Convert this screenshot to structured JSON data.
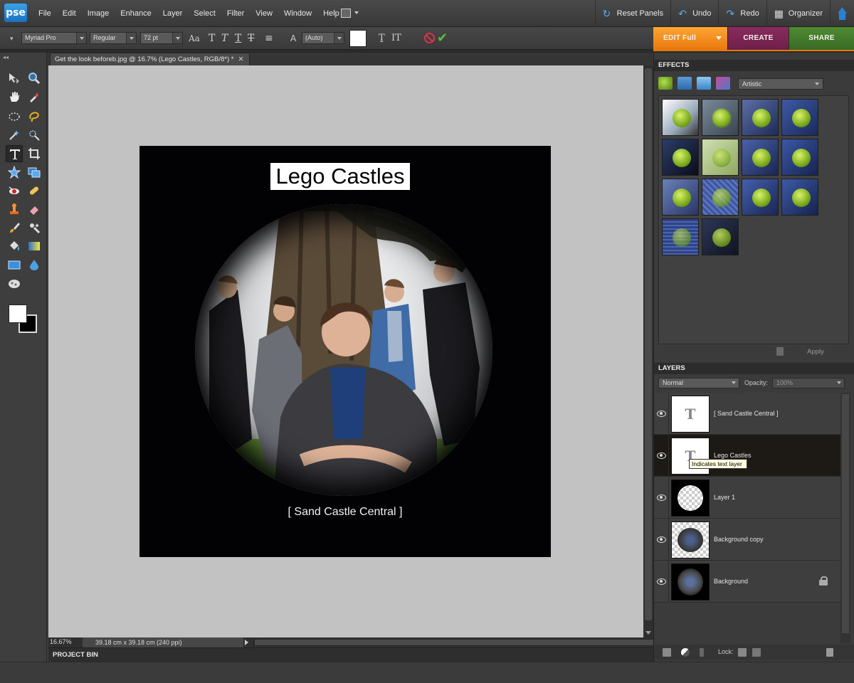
{
  "app": {
    "logo": "pse"
  },
  "menu": [
    "File",
    "Edit",
    "Image",
    "Enhance",
    "Layer",
    "Select",
    "Filter",
    "View",
    "Window",
    "Help"
  ],
  "header_actions": {
    "reset_panels": "Reset Panels",
    "undo": "Undo",
    "redo": "Redo",
    "organizer": "Organizer"
  },
  "options": {
    "font_family": "Myriad Pro",
    "font_style": "Regular",
    "font_size": "72 pt",
    "leading": "(Auto)",
    "text_color": "#ffffff"
  },
  "modes": {
    "edit": "EDIT Full",
    "create": "CREATE",
    "share": "SHARE"
  },
  "document": {
    "tab_title": "Get the look beforeb.jpg @ 16.7% (Lego Castles, RGB/8*) *",
    "close": "✕"
  },
  "canvas": {
    "title_text": "Lego Castles",
    "subtitle_text": "[ Sand Castle Central ]"
  },
  "status": {
    "zoom": "16.67%",
    "dimensions": "39.18 cm x 39.18 cm (240 ppi)"
  },
  "project_bin": {
    "title": "PROJECT BIN"
  },
  "effects": {
    "title": "EFFECTS",
    "category": "Artistic",
    "apply": "Apply",
    "thumbnail_count": 14
  },
  "layers": {
    "title": "LAYERS",
    "blend_mode": "Normal",
    "opacity_label": "Opacity:",
    "opacity": "100%",
    "tooltip": "Indicates text layer",
    "items": [
      {
        "name": "[ Sand Castle Central ]",
        "kind": "text",
        "visible": true,
        "selected": false,
        "locked": false
      },
      {
        "name": "Lego Castles",
        "kind": "text",
        "visible": true,
        "selected": true,
        "locked": false
      },
      {
        "name": "Layer 1",
        "kind": "circle",
        "visible": true,
        "selected": false,
        "locked": false
      },
      {
        "name": "Background copy",
        "kind": "photo-transparent",
        "visible": true,
        "selected": false,
        "locked": false
      },
      {
        "name": "Background",
        "kind": "photo",
        "visible": true,
        "selected": false,
        "locked": true
      }
    ],
    "lock_label": "Lock:"
  },
  "colors": {
    "edit_tab": "#e8780c",
    "create_tab": "#6d1f49",
    "share_tab": "#386b24",
    "accent_blue": "#2d7fd0"
  }
}
